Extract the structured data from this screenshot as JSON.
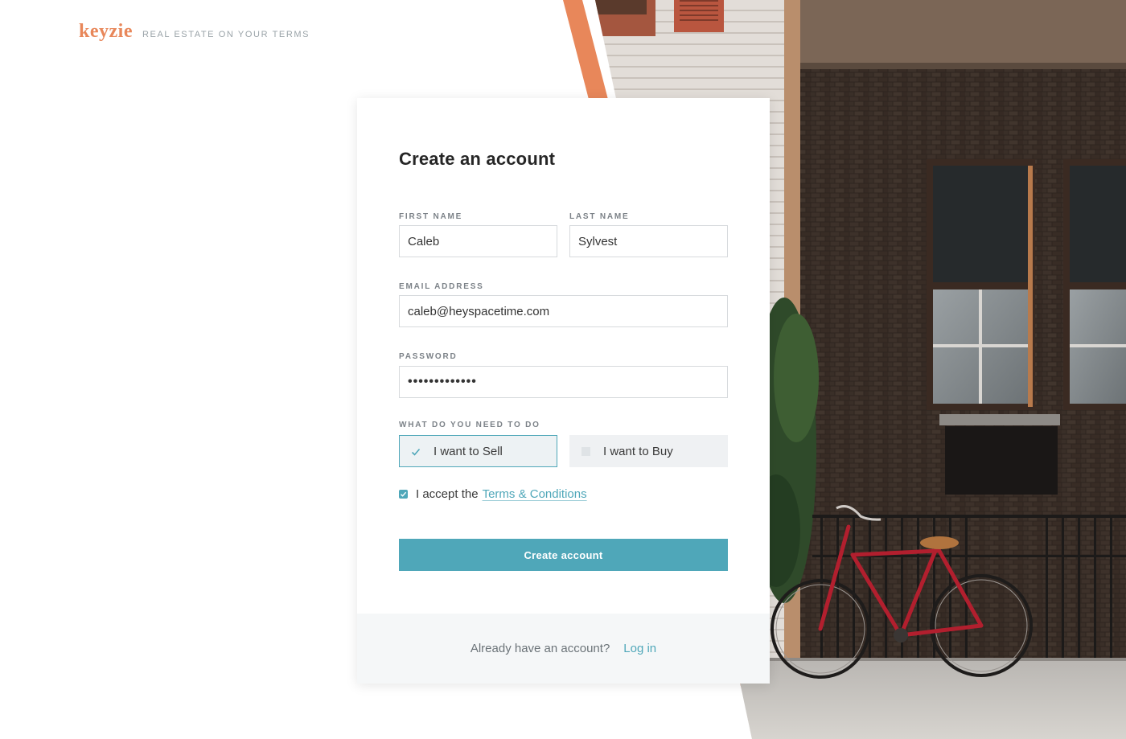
{
  "brand": {
    "logo": "keyzie",
    "tagline": "REAL ESTATE ON YOUR TERMS",
    "logo_color": "#e8875a"
  },
  "form": {
    "title": "Create an account",
    "first_name": {
      "label": "FIRST NAME",
      "value": "Caleb"
    },
    "last_name": {
      "label": "LAST NAME",
      "value": "Sylvest"
    },
    "email": {
      "label": "EMAIL ADDRESS",
      "value": "caleb@heyspacetime.com"
    },
    "password": {
      "label": "PASSWORD",
      "value": "•••••••••••••"
    },
    "intent": {
      "label": "WHAT DO YOU NEED TO DO",
      "options": [
        {
          "label": "I want to Sell",
          "selected": true
        },
        {
          "label": "I want to Buy",
          "selected": false
        }
      ]
    },
    "terms": {
      "prefix": "I accept the",
      "link": "Terms & Conditions",
      "checked": true
    },
    "submit_label": "Create account"
  },
  "footer": {
    "prompt": "Already have an account?",
    "login_label": "Log in"
  },
  "colors": {
    "accent": "#4fa7b9",
    "brand_orange": "#e8875a",
    "card_bg": "#ffffff",
    "footer_bg": "#f5f7f8"
  },
  "icons": {
    "sell_option": "checkmark-icon",
    "buy_option": "empty-checkbox-icon",
    "terms": "checked-checkbox-icon"
  }
}
